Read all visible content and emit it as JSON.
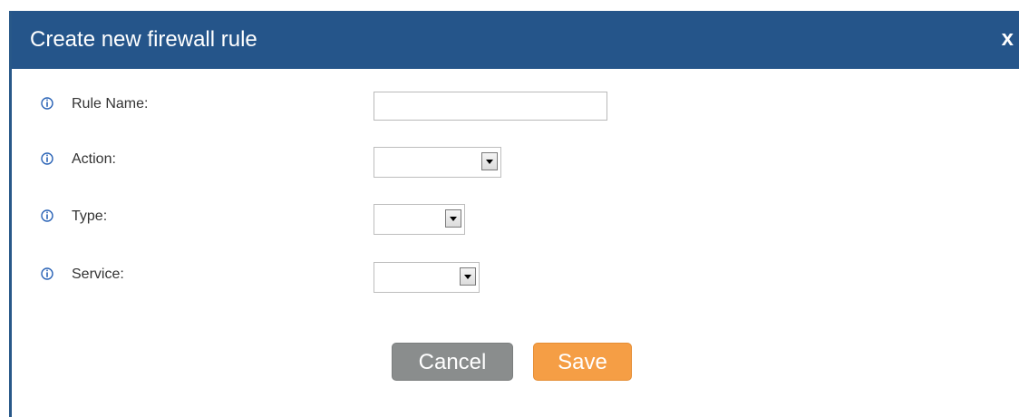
{
  "dialog": {
    "title": "Create new firewall rule",
    "close_label": "x"
  },
  "fields": {
    "rule_name": {
      "label": "Rule Name:",
      "value": ""
    },
    "action": {
      "label": "Action:",
      "value": ""
    },
    "type": {
      "label": "Type:",
      "value": ""
    },
    "service": {
      "label": "Service:",
      "value": ""
    }
  },
  "buttons": {
    "cancel": "Cancel",
    "save": "Save"
  },
  "colors": {
    "titlebar": "#25558a",
    "save": "#f59e45",
    "cancel": "#8a8d8d",
    "info_icon": "#2a63b6"
  }
}
